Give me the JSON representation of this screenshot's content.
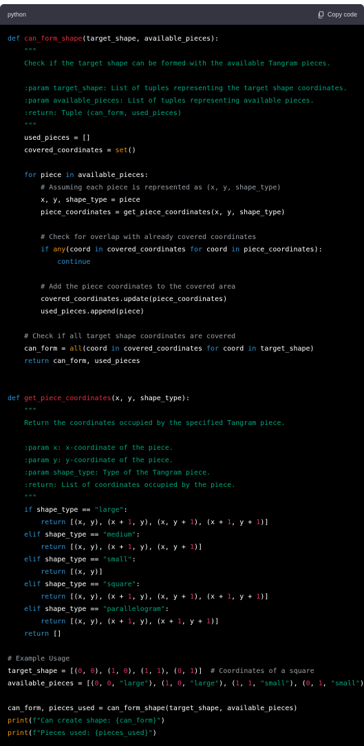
{
  "header": {
    "language": "python",
    "copy_label": "Copy code"
  },
  "colors": {
    "keyword": "#2e95d3",
    "function_name": "#f22c3d",
    "string": "#00a67d",
    "comment": "#9aa0a6",
    "number": "#df3079",
    "builtin": "#e9950c",
    "text": "#ffffff",
    "background": "#000000",
    "header_background": "#343541"
  },
  "code_lines": [
    [
      [
        "kw",
        "def "
      ],
      [
        "fn",
        "can_form_shape"
      ],
      [
        "t",
        "(target_shape, available_pieces):"
      ]
    ],
    [
      [
        "str",
        "    \"\"\""
      ]
    ],
    [
      [
        "str",
        "    Check if the target shape can be formed with the available Tangram pieces."
      ]
    ],
    [],
    [
      [
        "str",
        "    :param target_shape: List of tuples representing the target shape coordinates."
      ]
    ],
    [
      [
        "str",
        "    :param available_pieces: List of tuples representing available pieces."
      ]
    ],
    [
      [
        "str",
        "    :return: Tuple (can_form, used_pieces)"
      ]
    ],
    [
      [
        "str",
        "    \"\"\""
      ]
    ],
    [
      [
        "t",
        "    used_pieces = []"
      ]
    ],
    [
      [
        "t",
        "    covered_coordinates = "
      ],
      [
        "bi",
        "set"
      ],
      [
        "t",
        "()"
      ]
    ],
    [],
    [
      [
        "kw",
        "    for "
      ],
      [
        "t",
        "piece "
      ],
      [
        "kw",
        "in "
      ],
      [
        "t",
        "available_pieces:"
      ]
    ],
    [
      [
        "cmt",
        "        # Assuming each piece is represented as (x, y, shape_type)"
      ]
    ],
    [
      [
        "t",
        "        x, y, shape_type = piece"
      ]
    ],
    [
      [
        "t",
        "        piece_coordinates = get_piece_coordinates(x, y, shape_type)"
      ]
    ],
    [],
    [
      [
        "cmt",
        "        # Check for overlap with already covered coordinates"
      ]
    ],
    [
      [
        "kw",
        "        if "
      ],
      [
        "bi",
        "any"
      ],
      [
        "t",
        "(coord "
      ],
      [
        "kw",
        "in "
      ],
      [
        "t",
        "covered_coordinates "
      ],
      [
        "kw",
        "for "
      ],
      [
        "t",
        "coord "
      ],
      [
        "kw",
        "in "
      ],
      [
        "t",
        "piece_coordinates):"
      ]
    ],
    [
      [
        "kw",
        "            continue"
      ]
    ],
    [],
    [
      [
        "cmt",
        "        # Add the piece coordinates to the covered area"
      ]
    ],
    [
      [
        "t",
        "        covered_coordinates.update(piece_coordinates)"
      ]
    ],
    [
      [
        "t",
        "        used_pieces.append(piece)"
      ]
    ],
    [],
    [
      [
        "cmt",
        "    # Check if all target shape coordinates are covered"
      ]
    ],
    [
      [
        "t",
        "    can_form = "
      ],
      [
        "bi",
        "all"
      ],
      [
        "t",
        "(coord "
      ],
      [
        "kw",
        "in "
      ],
      [
        "t",
        "covered_coordinates "
      ],
      [
        "kw",
        "for "
      ],
      [
        "t",
        "coord "
      ],
      [
        "kw",
        "in "
      ],
      [
        "t",
        "target_shape)"
      ]
    ],
    [
      [
        "kw",
        "    return "
      ],
      [
        "t",
        "can_form, used_pieces"
      ]
    ],
    [],
    [],
    [
      [
        "kw",
        "def "
      ],
      [
        "fn",
        "get_piece_coordinates"
      ],
      [
        "t",
        "(x, y, shape_type):"
      ]
    ],
    [
      [
        "str",
        "    \"\"\""
      ]
    ],
    [
      [
        "str",
        "    Return the coordinates occupied by the specified Tangram piece."
      ]
    ],
    [],
    [
      [
        "str",
        "    :param x: x-coordinate of the piece."
      ]
    ],
    [
      [
        "str",
        "    :param y: y-coordinate of the piece."
      ]
    ],
    [
      [
        "str",
        "    :param shape_type: Type of the Tangram piece."
      ]
    ],
    [
      [
        "str",
        "    :return: List of coordinates occupied by the piece."
      ]
    ],
    [
      [
        "str",
        "    \"\"\""
      ]
    ],
    [
      [
        "kw",
        "    if "
      ],
      [
        "t",
        "shape_type == "
      ],
      [
        "str",
        "\"large\""
      ],
      [
        "t",
        ":"
      ]
    ],
    [
      [
        "kw",
        "        return "
      ],
      [
        "t",
        "[(x, y), (x + "
      ],
      [
        "num",
        "1"
      ],
      [
        "t",
        ", y), (x, y + "
      ],
      [
        "num",
        "1"
      ],
      [
        "t",
        "), (x + "
      ],
      [
        "num",
        "1"
      ],
      [
        "t",
        ", y + "
      ],
      [
        "num",
        "1"
      ],
      [
        "t",
        ")]"
      ]
    ],
    [
      [
        "kw",
        "    elif "
      ],
      [
        "t",
        "shape_type == "
      ],
      [
        "str",
        "\"medium\""
      ],
      [
        "t",
        ":"
      ]
    ],
    [
      [
        "kw",
        "        return "
      ],
      [
        "t",
        "[(x, y), (x + "
      ],
      [
        "num",
        "1"
      ],
      [
        "t",
        ", y), (x, y + "
      ],
      [
        "num",
        "1"
      ],
      [
        "t",
        ")]"
      ]
    ],
    [
      [
        "kw",
        "    elif "
      ],
      [
        "t",
        "shape_type == "
      ],
      [
        "str",
        "\"small\""
      ],
      [
        "t",
        ":"
      ]
    ],
    [
      [
        "kw",
        "        return "
      ],
      [
        "t",
        "[(x, y)]"
      ]
    ],
    [
      [
        "kw",
        "    elif "
      ],
      [
        "t",
        "shape_type == "
      ],
      [
        "str",
        "\"square\""
      ],
      [
        "t",
        ":"
      ]
    ],
    [
      [
        "kw",
        "        return "
      ],
      [
        "t",
        "[(x, y), (x + "
      ],
      [
        "num",
        "1"
      ],
      [
        "t",
        ", y), (x, y + "
      ],
      [
        "num",
        "1"
      ],
      [
        "t",
        "), (x + "
      ],
      [
        "num",
        "1"
      ],
      [
        "t",
        ", y + "
      ],
      [
        "num",
        "1"
      ],
      [
        "t",
        ")]"
      ]
    ],
    [
      [
        "kw",
        "    elif "
      ],
      [
        "t",
        "shape_type == "
      ],
      [
        "str",
        "\"parallelogram\""
      ],
      [
        "t",
        ":"
      ]
    ],
    [
      [
        "kw",
        "        return "
      ],
      [
        "t",
        "[(x, y), (x + "
      ],
      [
        "num",
        "1"
      ],
      [
        "t",
        ", y), (x + "
      ],
      [
        "num",
        "1"
      ],
      [
        "t",
        ", y + "
      ],
      [
        "num",
        "1"
      ],
      [
        "t",
        ")]"
      ]
    ],
    [
      [
        "kw",
        "    return "
      ],
      [
        "t",
        "[]"
      ]
    ],
    [],
    [
      [
        "cmt",
        "# Example Usage"
      ]
    ],
    [
      [
        "t",
        "target_shape = [("
      ],
      [
        "num",
        "0"
      ],
      [
        "t",
        ", "
      ],
      [
        "num",
        "0"
      ],
      [
        "t",
        "), ("
      ],
      [
        "num",
        "1"
      ],
      [
        "t",
        ", "
      ],
      [
        "num",
        "0"
      ],
      [
        "t",
        "), ("
      ],
      [
        "num",
        "1"
      ],
      [
        "t",
        ", "
      ],
      [
        "num",
        "1"
      ],
      [
        "t",
        "), ("
      ],
      [
        "num",
        "0"
      ],
      [
        "t",
        ", "
      ],
      [
        "num",
        "1"
      ],
      [
        "t",
        ")]  "
      ],
      [
        "cmt",
        "# Coordinates of a square"
      ]
    ],
    [
      [
        "t",
        "available_pieces = [("
      ],
      [
        "num",
        "0"
      ],
      [
        "t",
        ", "
      ],
      [
        "num",
        "0"
      ],
      [
        "t",
        ", "
      ],
      [
        "str",
        "\"large\""
      ],
      [
        "t",
        "), ("
      ],
      [
        "num",
        "1"
      ],
      [
        "t",
        ", "
      ],
      [
        "num",
        "0"
      ],
      [
        "t",
        ", "
      ],
      [
        "str",
        "\"large\""
      ],
      [
        "t",
        "), ("
      ],
      [
        "num",
        "1"
      ],
      [
        "t",
        ", "
      ],
      [
        "num",
        "1"
      ],
      [
        "t",
        ", "
      ],
      [
        "str",
        "\"small\""
      ],
      [
        "t",
        "), ("
      ],
      [
        "num",
        "0"
      ],
      [
        "t",
        ", "
      ],
      [
        "num",
        "1"
      ],
      [
        "t",
        ", "
      ],
      [
        "str",
        "\"small\""
      ],
      [
        "t",
        ")]"
      ]
    ],
    [],
    [
      [
        "t",
        "can_form, pieces_used = can_form_shape(target_shape, available_pieces)"
      ]
    ],
    [
      [
        "bi",
        "print"
      ],
      [
        "t",
        "("
      ],
      [
        "str",
        "f\"Can create shape: {can_form}\""
      ],
      [
        "t",
        ")"
      ]
    ],
    [
      [
        "bi",
        "print"
      ],
      [
        "t",
        "("
      ],
      [
        "str",
        "f\"Pieces used: {pieces_used}\""
      ],
      [
        "t",
        ")"
      ]
    ]
  ]
}
